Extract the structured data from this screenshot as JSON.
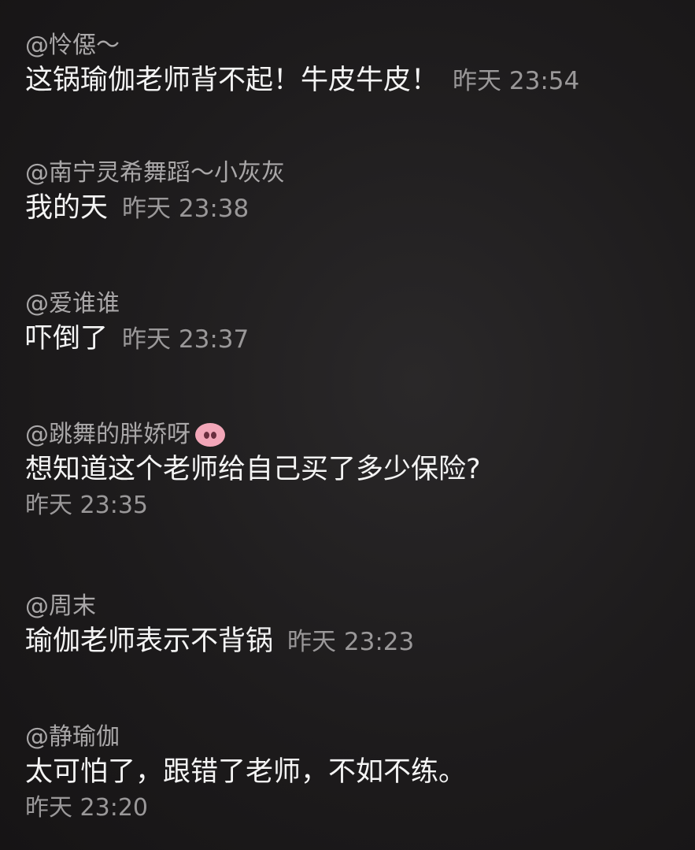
{
  "comments": [
    {
      "user": "@怜僫～",
      "text": "这锅瑜伽老师背不起！牛皮牛皮！",
      "time": "昨天 23:54"
    },
    {
      "user": "@南宁灵希舞蹈～小灰灰",
      "text": "我的天",
      "time": "昨天 23:38"
    },
    {
      "user": "@爱谁谁",
      "text": "吓倒了",
      "time": "昨天 23:37"
    },
    {
      "user": "@跳舞的胖娇呀",
      "user_icon": "pig-nose-icon",
      "text": "想知道这个老师给自己买了多少保险?",
      "time": "昨天 23:35"
    },
    {
      "user": "@周末",
      "text": "瑜伽老师表示不背锅",
      "time": "昨天 23:23"
    },
    {
      "user": "@静瑜伽",
      "text": "太可怕了，跟错了老师，不如不练。",
      "time": "昨天 23:20"
    }
  ]
}
